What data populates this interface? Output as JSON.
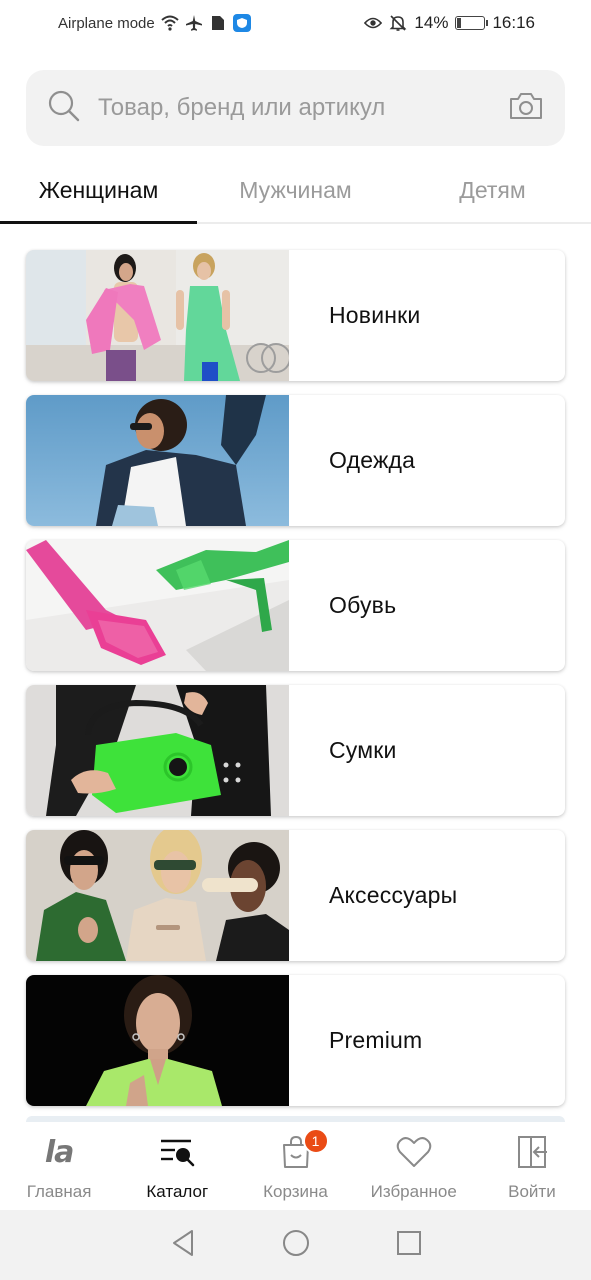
{
  "status_bar": {
    "left_text": "Airplane mode",
    "battery_percent": "14%",
    "battery_level": 0.14,
    "time": "16:16"
  },
  "search": {
    "placeholder": "Товар, бренд или артикул",
    "value": ""
  },
  "tabs": [
    {
      "label": "Женщинам",
      "active": true
    },
    {
      "label": "Мужчинам",
      "active": false
    },
    {
      "label": "Детям",
      "active": false
    }
  ],
  "categories": [
    {
      "label": "Новинки",
      "image": "new-arrivals-photo"
    },
    {
      "label": "Одежда",
      "image": "clothing-photo"
    },
    {
      "label": "Обувь",
      "image": "shoes-photo"
    },
    {
      "label": "Сумки",
      "image": "bags-photo"
    },
    {
      "label": "Аксессуары",
      "image": "accessories-photo"
    },
    {
      "label": "Premium",
      "image": "premium-photo"
    }
  ],
  "bottom_nav": {
    "items": [
      {
        "label": "Главная",
        "icon": "la-logo-icon",
        "active": false
      },
      {
        "label": "Каталог",
        "icon": "catalog-search-icon",
        "active": true
      },
      {
        "label": "Корзина",
        "icon": "shopping-bag-icon",
        "active": false,
        "badge": "1"
      },
      {
        "label": "Избранное",
        "icon": "heart-icon",
        "active": false
      },
      {
        "label": "Войти",
        "icon": "login-door-icon",
        "active": false
      }
    ]
  },
  "colors": {
    "accent_badge": "#ea4b15",
    "search_bg": "#f2f2f2",
    "text_primary": "#111111",
    "text_muted": "#9b9b9b"
  }
}
